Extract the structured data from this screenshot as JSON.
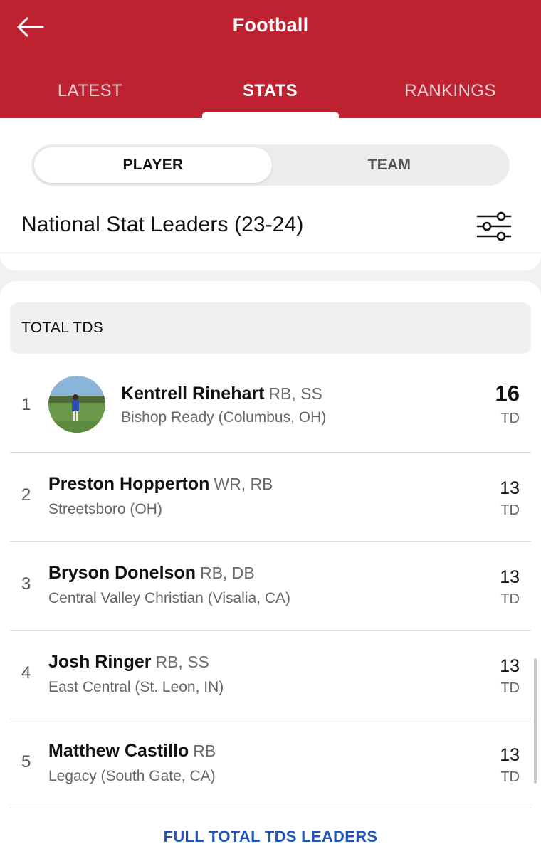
{
  "header": {
    "title": "Football",
    "back_icon": "arrow-left-icon",
    "tabs": [
      {
        "label": "LATEST",
        "active": false
      },
      {
        "label": "STATS",
        "active": true
      },
      {
        "label": "RANKINGS",
        "active": false
      }
    ],
    "color": "#be2231"
  },
  "segment": {
    "options": [
      "PLAYER",
      "TEAM"
    ],
    "selected": "PLAYER"
  },
  "section": {
    "title": "National Stat Leaders (23-24)",
    "filter_icon": "sliders-icon"
  },
  "leaders": {
    "category": "TOTAL TDS",
    "rows": [
      {
        "rank": "1",
        "name": "Kentrell Rinehart",
        "positions": "RB, SS",
        "school": "Bishop Ready (Columbus, OH)",
        "value": "16",
        "unit": "TD",
        "has_photo": true
      },
      {
        "rank": "2",
        "name": "Preston Hopperton",
        "positions": "WR, RB",
        "school": "Streetsboro (OH)",
        "value": "13",
        "unit": "TD"
      },
      {
        "rank": "3",
        "name": "Bryson Donelson",
        "positions": "RB, DB",
        "school": "Central Valley Christian (Visalia, CA)",
        "value": "13",
        "unit": "TD"
      },
      {
        "rank": "4",
        "name": "Josh Ringer",
        "positions": "RB, SS",
        "school": "East Central (St. Leon, IN)",
        "value": "13",
        "unit": "TD"
      },
      {
        "rank": "5",
        "name": "Matthew Castillo",
        "positions": "RB",
        "school": "Legacy (South Gate, CA)",
        "value": "13",
        "unit": "TD"
      }
    ],
    "full_link": "FULL TOTAL TDS LEADERS",
    "link_color": "#2156b8"
  }
}
